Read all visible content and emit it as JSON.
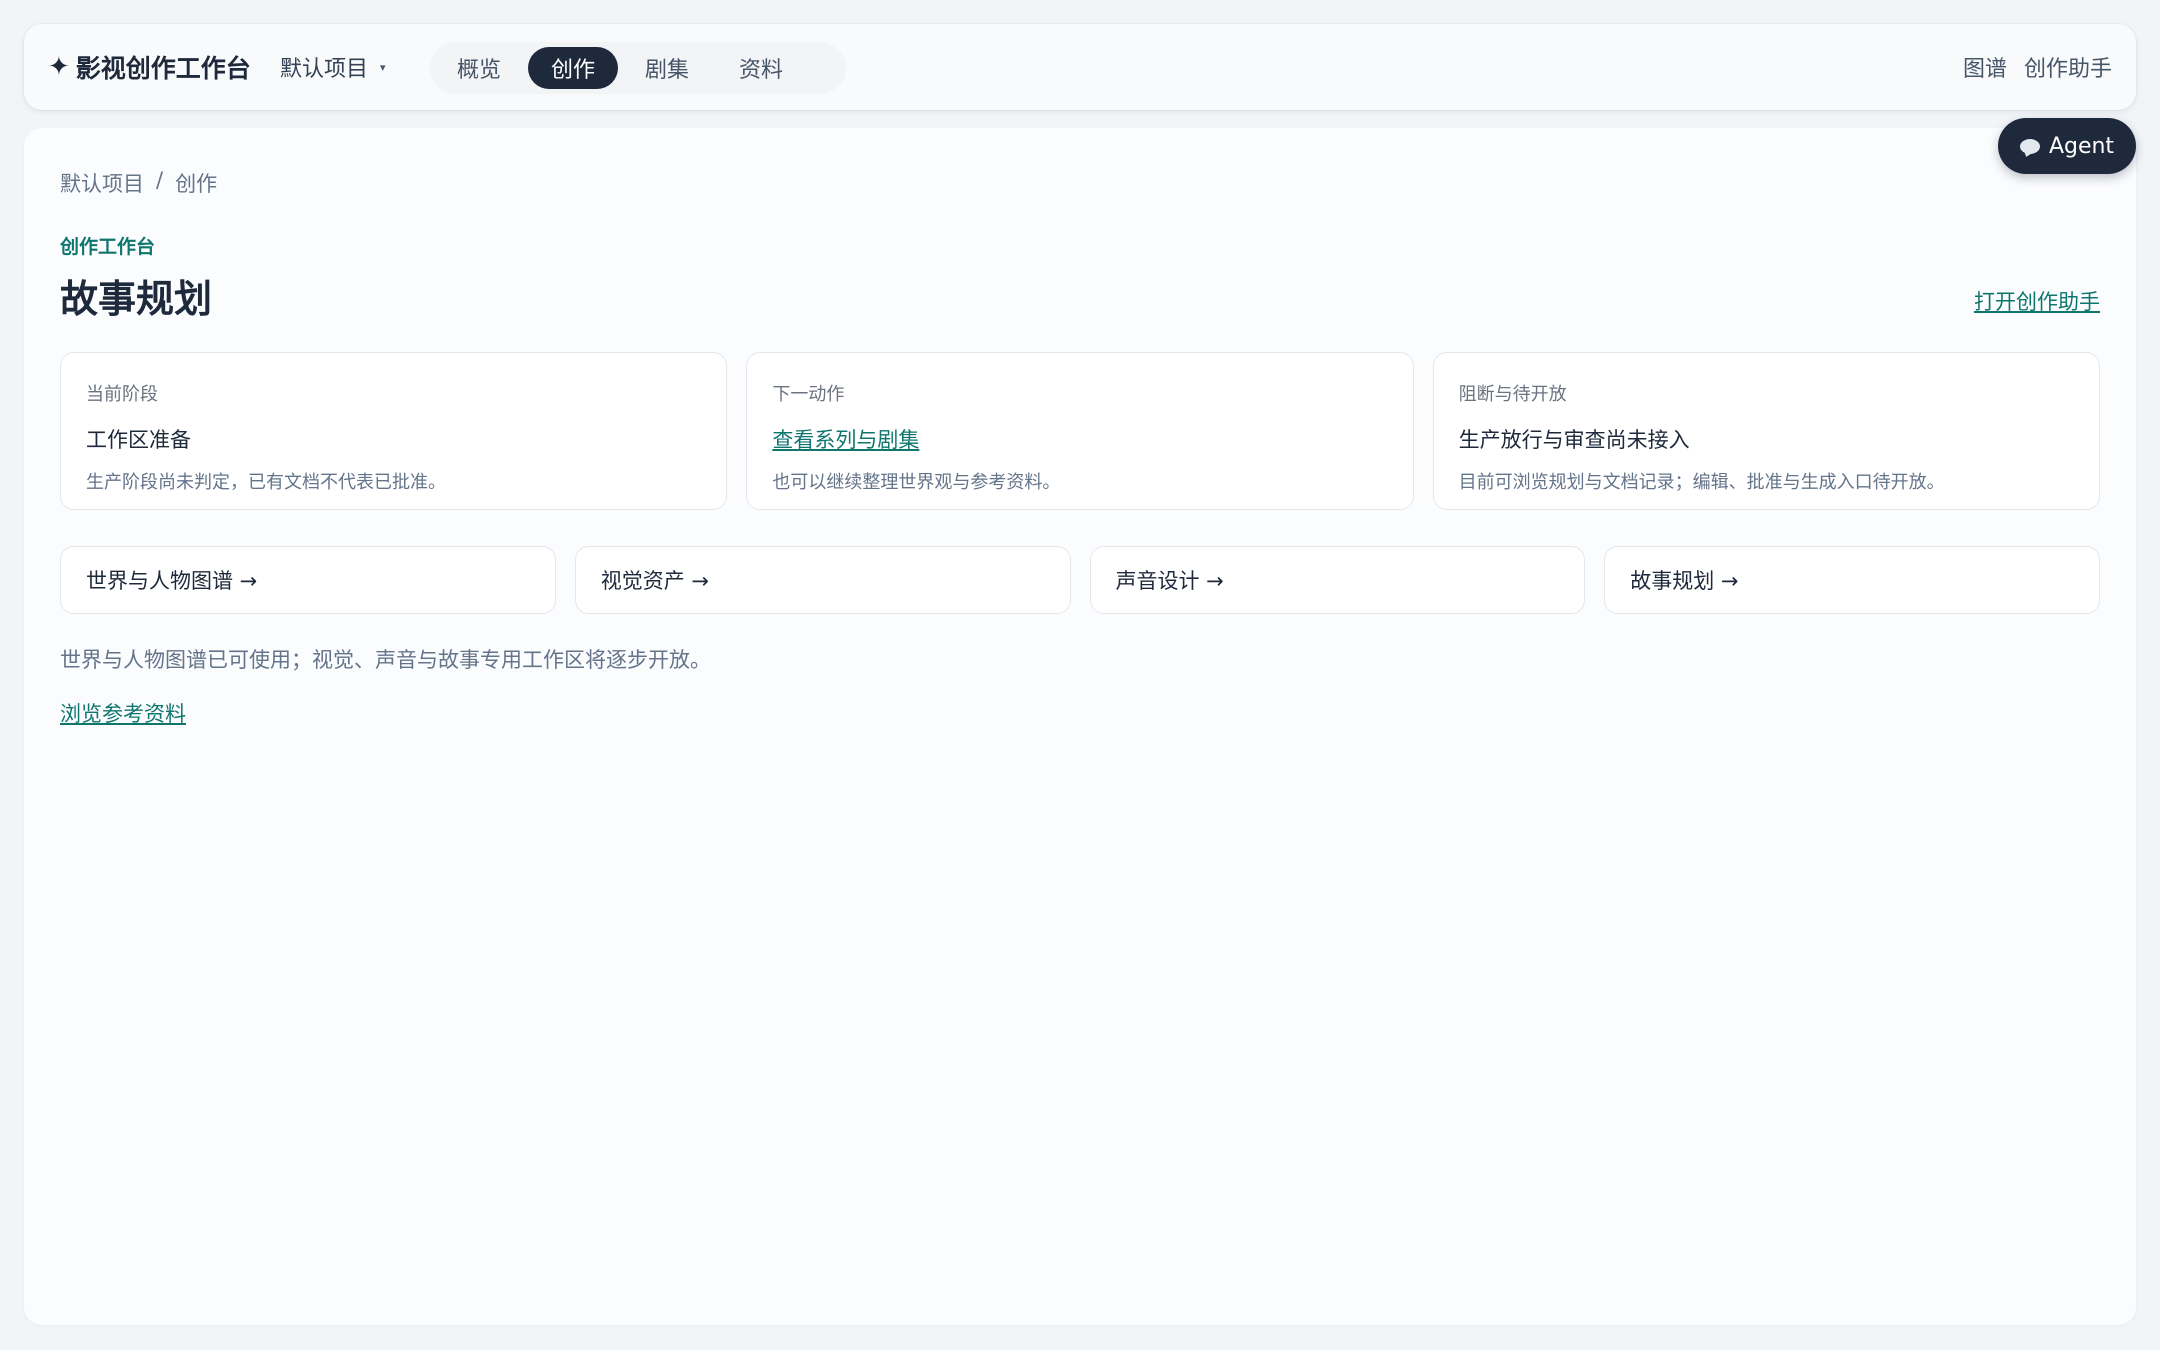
{
  "app": {
    "brand_icon": "✦",
    "brand_name": "影视创作工作台",
    "project_select": "默认项目",
    "project_caret": "▾"
  },
  "nav": {
    "tabs": [
      {
        "label": "概览",
        "active": false
      },
      {
        "label": "创作",
        "active": true
      },
      {
        "label": "剧集",
        "active": false
      },
      {
        "label": "资料",
        "active": false
      }
    ]
  },
  "header_right": {
    "graph_link": "图谱",
    "assistant_link": "创作助手"
  },
  "agent": {
    "label": "Agent",
    "icon": "chat-bubble-icon"
  },
  "breadcrumb": {
    "items": [
      "默认项目",
      "创作"
    ],
    "separator": "/"
  },
  "page": {
    "eyebrow": "创作工作台",
    "title": "故事规划",
    "open_assistant": "打开创作助手"
  },
  "status_cards": [
    {
      "label": "当前阶段",
      "title": "工作区准备",
      "desc": "生产阶段尚未判定，已有文档不代表已批准。",
      "title_is_link": false
    },
    {
      "label": "下一动作",
      "title": "查看系列与剧集",
      "desc": "也可以继续整理世界观与参考资料。",
      "title_is_link": true
    },
    {
      "label": "阻断与待开放",
      "title": "生产放行与审查尚未接入",
      "desc": "目前可浏览规划与文档记录；编辑、批准与生成入口待开放。",
      "title_is_link": false
    }
  ],
  "quick_links": [
    "世界与人物图谱 →",
    "视觉资产 →",
    "声音设计 →",
    "故事规划 →"
  ],
  "note": "世界与人物图谱已可使用；视觉、声音与故事专用工作区将逐步开放。",
  "browse_link": "浏览参考资料",
  "colors": {
    "accent": "#0f766e",
    "dark": "#1e293b",
    "background": "#f2f5f8"
  }
}
